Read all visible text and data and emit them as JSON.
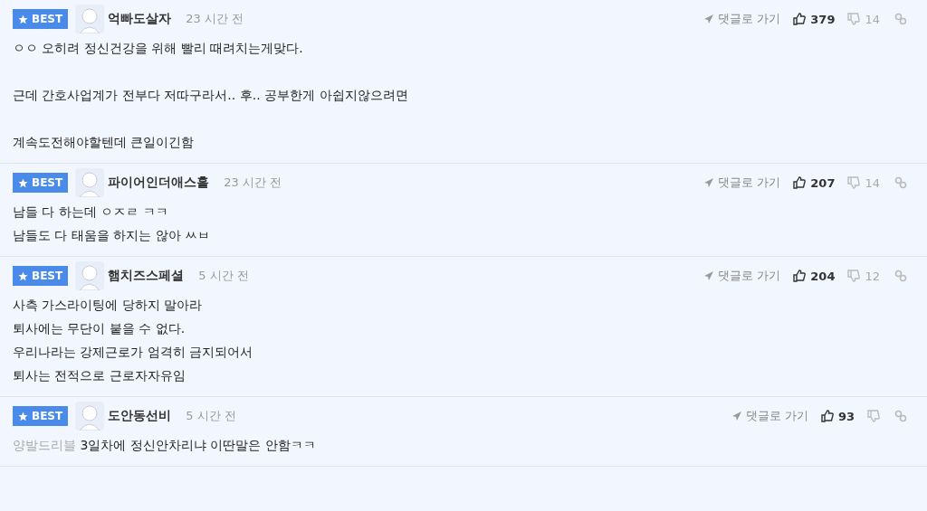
{
  "comments": [
    {
      "best_label": "BEST",
      "author": "억빠도살자",
      "time": "23 시간 전",
      "goto": "댓글로 가기",
      "likes": "379",
      "dislikes": "14",
      "paragraphs": [
        [
          "ㅇㅇ 오히려 정신건강을 위해 빨리 때려치는게맞다."
        ],
        [
          "근데 간호사업계가 전부다 저따구라서.. 후.. 공부한게 아쉽지않으려면"
        ],
        [
          "계속도전해야할텐데 큰일이긴함"
        ]
      ]
    },
    {
      "best_label": "BEST",
      "author": "파이어인더애스홀",
      "time": "23 시간 전",
      "goto": "댓글로 가기",
      "likes": "207",
      "dislikes": "14",
      "paragraphs": [
        [
          "남들 다 하는데 ㅇㅈㄹ ㅋㅋ",
          "남들도 다 태움을 하지는 않아 ㅆㅂ"
        ]
      ]
    },
    {
      "best_label": "BEST",
      "author": "햄치즈스페셜",
      "time": "5 시간 전",
      "goto": "댓글로 가기",
      "likes": "204",
      "dislikes": "12",
      "paragraphs": [
        [
          "사측 가스라이팅에 당하지 말아라",
          "퇴사에는 무단이 붙을 수 없다.",
          "우리나라는 강제근로가 엄격히 금지되어서",
          "퇴사는 전적으로 근로자자유임"
        ]
      ]
    },
    {
      "best_label": "BEST",
      "author": "도안동선비",
      "time": "5 시간 전",
      "goto": "댓글로 가기",
      "likes": "93",
      "mention": "양발드리블",
      "paragraphs": [
        [
          "3일차에 정신안차리냐 이딴말은 안함ㅋㅋ"
        ]
      ]
    }
  ]
}
